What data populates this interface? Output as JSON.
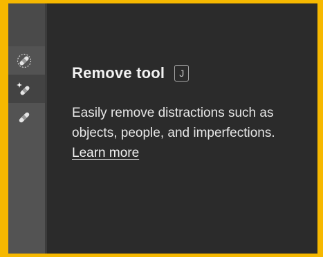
{
  "toolbar": {
    "tools": [
      {
        "name": "Spot Healing Brush tool",
        "icon": "spot-bandage-icon"
      },
      {
        "name": "Remove tool",
        "icon": "sparkle-bandage-icon",
        "active": true
      },
      {
        "name": "Healing Brush tool",
        "icon": "bandage-icon"
      }
    ]
  },
  "popover": {
    "title": "Remove tool",
    "shortcut": "J",
    "description": "Easily remove distractions such as objects, people, and imperfections.",
    "learn_more": "Learn more"
  },
  "colors": {
    "frame_border": "#f6b800",
    "panel_bg": "#2b2b2b",
    "toolbar_bg": "#535353",
    "active_tool_bg": "#434343",
    "text": "#f2f2f2"
  }
}
